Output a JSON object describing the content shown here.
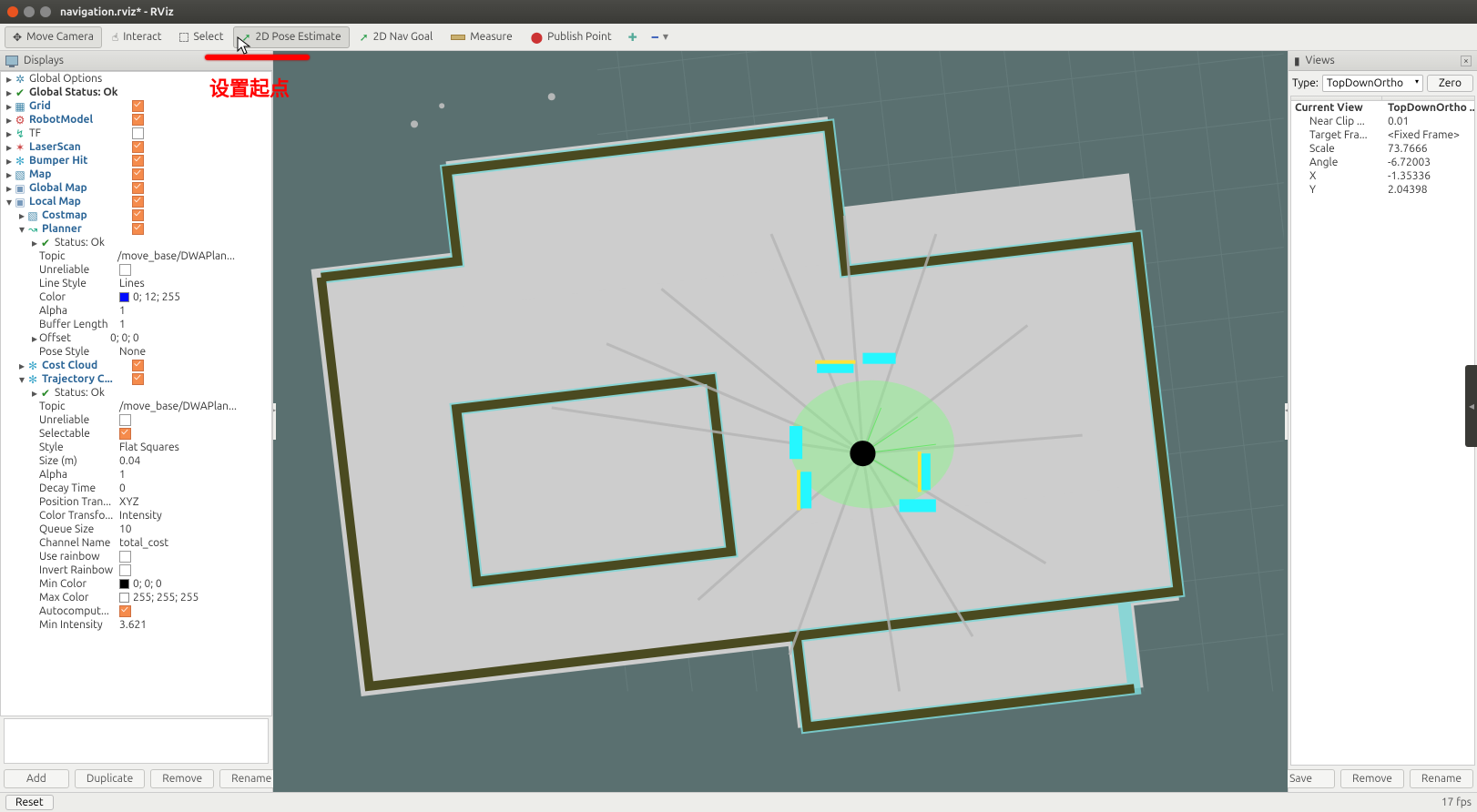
{
  "window": {
    "title": "navigation.rviz* - RViz"
  },
  "toolbar": {
    "move_camera": "Move Camera",
    "interact": "Interact",
    "select": "Select",
    "pose_estimate": "2D Pose Estimate",
    "nav_goal": "2D Nav Goal",
    "measure": "Measure",
    "publish_point": "Publish Point"
  },
  "left": {
    "header": "Displays",
    "add": "Add",
    "duplicate": "Duplicate",
    "remove": "Remove",
    "rename": "Rename"
  },
  "tree": {
    "global_options": "Global Options",
    "global_status": "Global Status: Ok",
    "grid": "Grid",
    "robot_model": "RobotModel",
    "tf": "TF",
    "laser_scan": "LaserScan",
    "bumper_hit": "Bumper Hit",
    "map": "Map",
    "global_map": "Global Map",
    "local_map": "Local Map",
    "costmap": "Costmap",
    "planner": "Planner",
    "planner_status": "Status: Ok",
    "planner_topic_k": "Topic",
    "planner_topic_v": "/move_base/DWAPlan...",
    "unreliable_k": "Unreliable",
    "line_style_k": "Line Style",
    "line_style_v": "Lines",
    "color_k": "Color",
    "color_v": "0; 12; 255",
    "alpha_k": "Alpha",
    "alpha_v": "1",
    "buffer_len_k": "Buffer Length",
    "buffer_len_v": "1",
    "offset_k": "Offset",
    "offset_v": "0; 0; 0",
    "pose_style_k": "Pose Style",
    "pose_style_v": "None",
    "cost_cloud": "Cost Cloud",
    "trajectory_cloud": "Trajectory C...",
    "traj_status": "Status: Ok",
    "traj_topic_v": "/move_base/DWAPlan...",
    "selectable_k": "Selectable",
    "style_k": "Style",
    "style_v": "Flat Squares",
    "size_k": "Size (m)",
    "size_v": "0.04",
    "alpha2_v": "1",
    "decay_k": "Decay Time",
    "decay_v": "0",
    "pos_trans_k": "Position Tran...",
    "pos_trans_v": "XYZ",
    "col_trans_k": "Color Transfo...",
    "col_trans_v": "Intensity",
    "queue_k": "Queue Size",
    "queue_v": "10",
    "channel_k": "Channel Name",
    "channel_v": "total_cost",
    "rainbow_k": "Use rainbow",
    "invert_k": "Invert Rainbow",
    "min_col_k": "Min Color",
    "min_col_v": "0; 0; 0",
    "max_col_k": "Max Color",
    "max_col_v": "255; 255; 255",
    "autocomp_k": "Autocomput...",
    "min_int_k": "Min Intensity",
    "min_int_v": "3.621"
  },
  "right": {
    "header": "Views",
    "type_label": "Type:",
    "type_value": "TopDownOrtho",
    "zero": "Zero",
    "head_name": "Current View",
    "head_val": "TopDownOrtho ...",
    "near_k": "Near Clip ...",
    "near_v": "0.01",
    "target_k": "Target Fra...",
    "target_v": "<Fixed Frame>",
    "scale_k": "Scale",
    "scale_v": "73.7666",
    "angle_k": "Angle",
    "angle_v": "-6.72003",
    "x_k": "X",
    "x_v": "-1.35336",
    "y_k": "Y",
    "y_v": "2.04398",
    "save": "Save",
    "remove": "Remove",
    "rename": "Rename"
  },
  "status": {
    "reset": "Reset",
    "fps": "17 fps"
  },
  "annotation": {
    "text": "设置起点"
  }
}
